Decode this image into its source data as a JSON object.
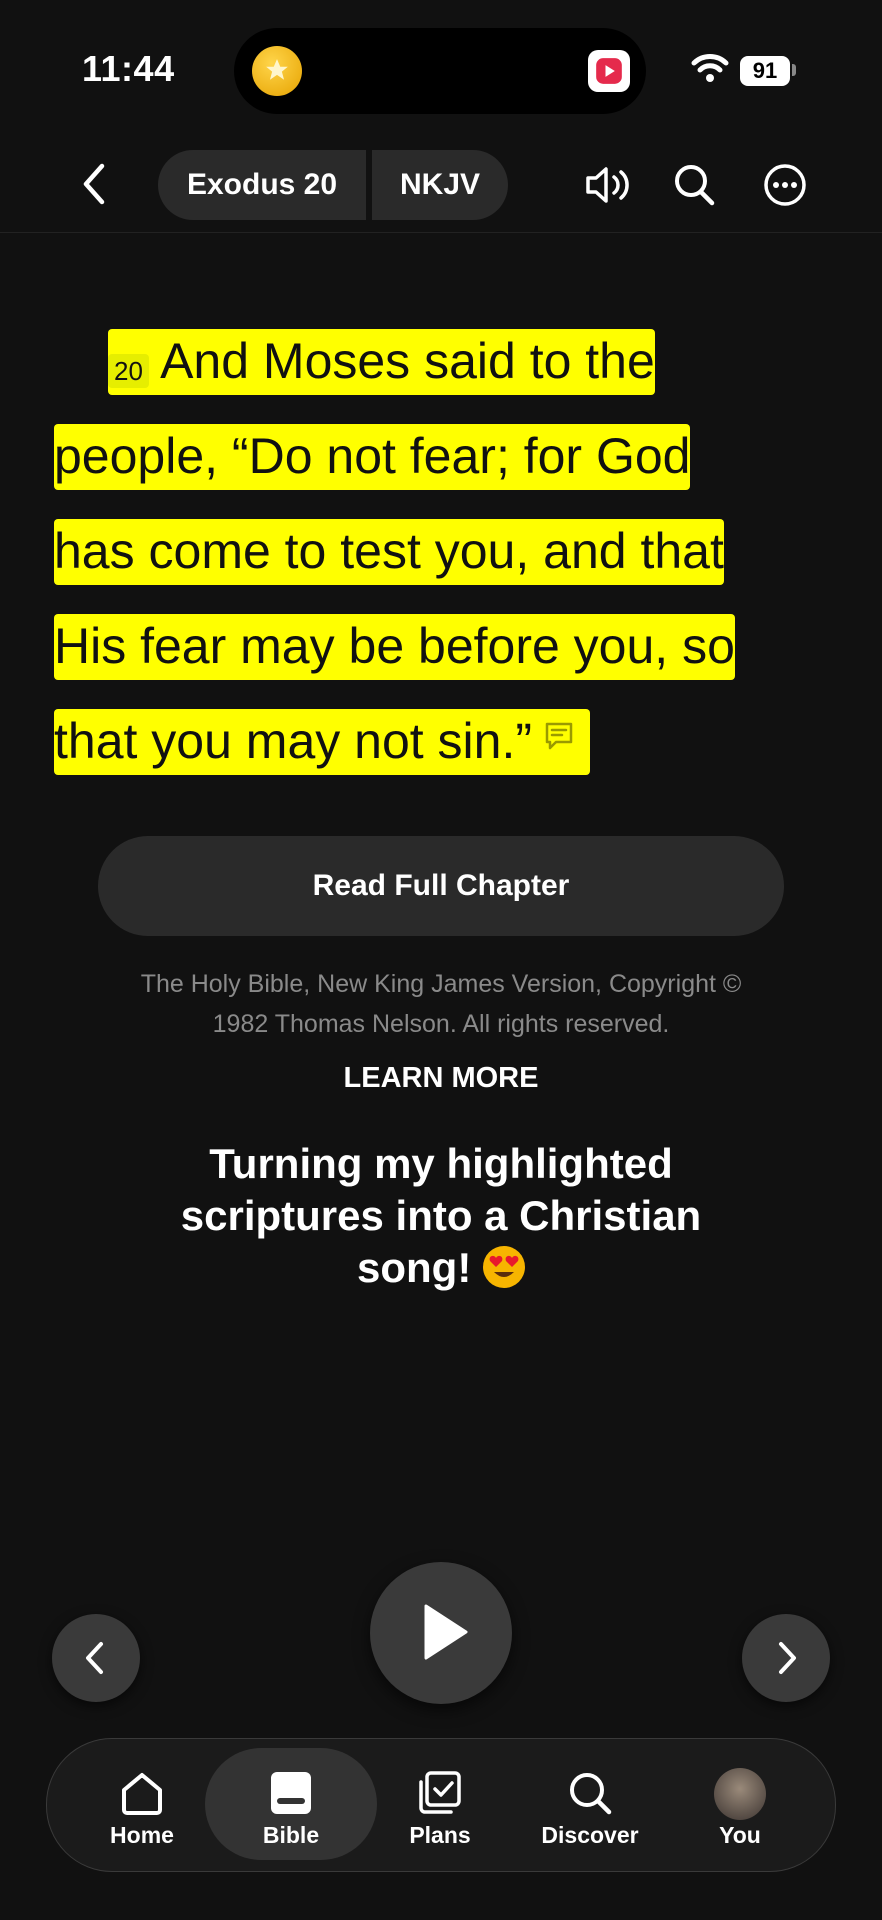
{
  "status_bar": {
    "time": "11:44",
    "battery": "91"
  },
  "header": {
    "book": "Exodus 20",
    "version": "NKJV"
  },
  "verse": {
    "number": "20",
    "line1": "And Moses said to the",
    "line2": "people, “Do not fear; for God",
    "line3": "has come to test you, and that",
    "line4": "His fear may be before you, so",
    "line5": "that you may not sin.”",
    "highlight_color": "#ffff00"
  },
  "read_full_chapter": "Read Full Chapter",
  "copyright": "The Holy Bible, New King James Version, Copyright © 1982 Thomas Nelson. All rights reserved.",
  "learn_more": "LEARN MORE",
  "caption": "Turning my highlighted scriptures into a Christian song!",
  "tabs": [
    {
      "label": "Home",
      "icon": "home-icon"
    },
    {
      "label": "Bible",
      "icon": "bible-icon",
      "active": true
    },
    {
      "label": "Plans",
      "icon": "plans-icon"
    },
    {
      "label": "Discover",
      "icon": "search-icon"
    },
    {
      "label": "You",
      "icon": "avatar"
    }
  ]
}
